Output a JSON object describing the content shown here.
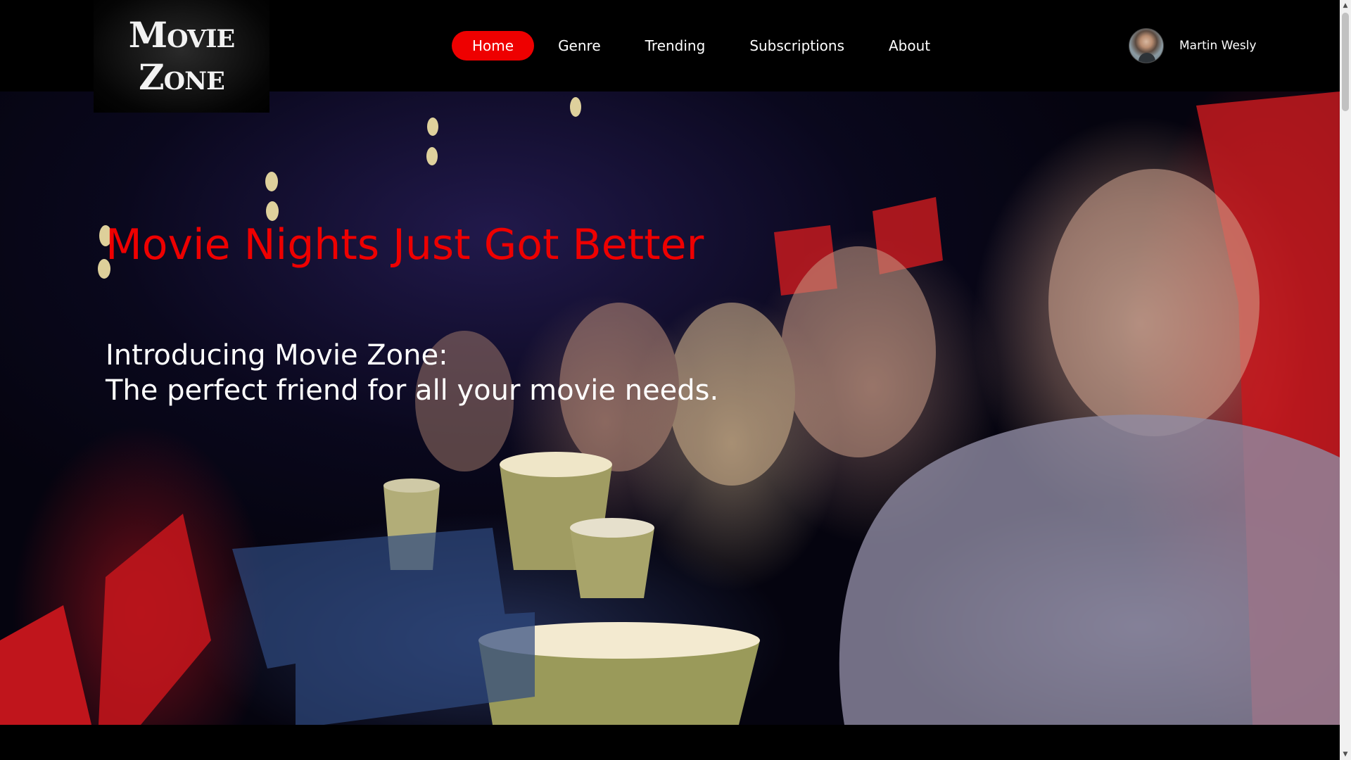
{
  "logo": {
    "line1": "Movie",
    "line2": "Zone"
  },
  "nav": {
    "items": [
      {
        "label": "Home",
        "active": true
      },
      {
        "label": "Genre",
        "active": false
      },
      {
        "label": "Trending",
        "active": false
      },
      {
        "label": "Subscriptions",
        "active": false
      },
      {
        "label": "About",
        "active": false
      }
    ]
  },
  "user": {
    "name": "Martin Wesly",
    "avatar_icon": "user-avatar"
  },
  "hero": {
    "title": "Movie Nights Just Got Better",
    "subtitle_line1": "Introducing Movie Zone:",
    "subtitle_line2": "The perfect friend for all your movie needs."
  },
  "colors": {
    "accent": "#ee0000",
    "background": "#000000",
    "text": "#ffffff"
  }
}
